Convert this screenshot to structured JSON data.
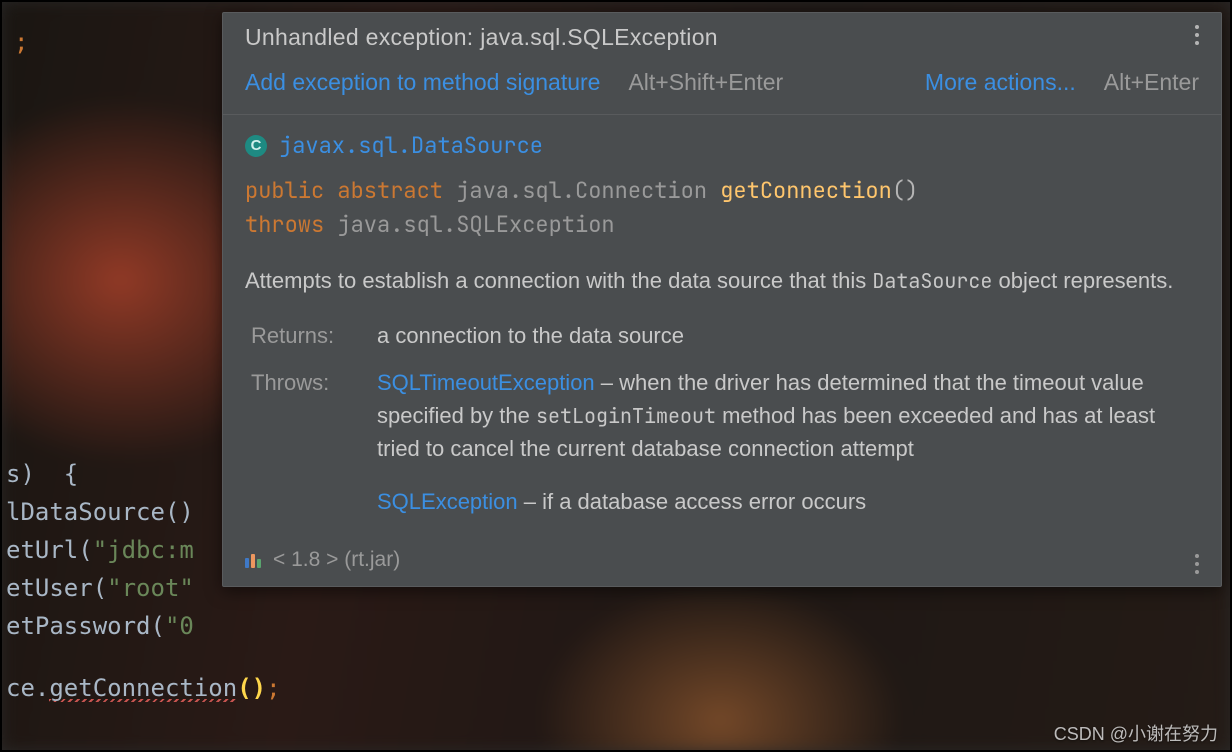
{
  "editor": {
    "line_semicolon": ";",
    "line_args": "s)  {",
    "line_ds": "lDataSource()",
    "line_url_prefix": "etUrl(",
    "line_url_str": "\"jdbc:m",
    "line_user_prefix": "etUser(",
    "line_user_str": "\"root\"",
    "line_pw_prefix": "etPassword(",
    "line_pw_str": "\"0",
    "line_conn_prefix": "ce.",
    "line_conn_call": "getConnection",
    "line_conn_open": "(",
    "line_conn_close": ")",
    "line_conn_semi": ";"
  },
  "popup": {
    "title": "Unhandled exception: java.sql.SQLException",
    "action1": "Add exception to method signature",
    "shortcut1": "Alt+Shift+Enter",
    "action2": "More actions...",
    "shortcut2": "Alt+Enter",
    "class_badge": "C",
    "class_fqname": "javax.sql.DataSource",
    "sig_public": "public",
    "sig_abstract": "abstract",
    "sig_ret": "java.sql.Connection",
    "sig_name": "getConnection",
    "sig_parens": "()",
    "sig_throws_kw": "throws",
    "sig_throws_ex": "java.sql.SQLException",
    "desc_lead": "Attempts to establish a connection with the data source that this ",
    "desc_code": "DataSource",
    "desc_tail": " object represents.",
    "returns_label": "Returns:",
    "returns_text": "a connection to the data source",
    "throws_label": "Throws:",
    "throws_1_link": "SQLTimeoutException",
    "throws_1_pre": " – when the driver has determined that the timeout value specified by the ",
    "throws_1_code": "setLoginTimeout",
    "throws_1_post": " method has been exceeded and has at least tried to cancel the current database connection attempt",
    "throws_2_link": "SQLException",
    "throws_2_text": " – if a database access error occurs",
    "footer_text": "< 1.8 > (rt.jar)"
  },
  "watermark": "CSDN @小谢在努力"
}
